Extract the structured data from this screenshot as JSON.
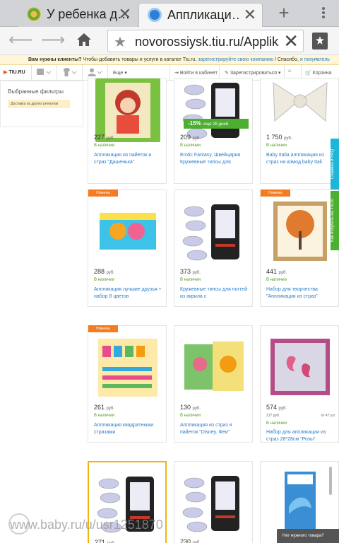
{
  "browser": {
    "tabs": [
      {
        "title": "У ребенка д…",
        "active": false
      },
      {
        "title": "Аппликаци…",
        "active": true
      }
    ],
    "new_tab_symbol": "+",
    "url": "novorossiysk.tiu.ru/Applikats",
    "icons": {
      "back": "arrow-left-icon",
      "forward": "arrow-right-icon",
      "home": "home-icon",
      "star": "star-icon",
      "clear": "close-icon",
      "bookmarks": "bookmarks-icon"
    }
  },
  "promo_bar": {
    "bold": "Вам нужны клиенты?",
    "text": " Чтобы добавить товары и услуги в каталог Tiu.ru, ",
    "link1": "зарегистрируйте свою компанию",
    "text2": " / Спасибо, ",
    "link2": "я покупатель",
    "close": "×"
  },
  "site_header": {
    "logo": "TIU.RU",
    "more": "Еще",
    "login": "Войти в кабинет",
    "register": "Зарегистрироваться",
    "cart": "Корзина"
  },
  "sidebar": {
    "title": "Выбранные фильтры",
    "chip": "Доставка из других регионов"
  },
  "products": [
    {
      "price": "227",
      "currency": "руб.",
      "stock": "В наличии",
      "title": "Аппликация из пайеток и страз \"Дашенька\"",
      "badge": "",
      "img": "doll"
    },
    {
      "price": "209",
      "currency": "руб.",
      "stock": "В наличии",
      "title": "Erotic Fantasy, Швейцария Кружевные типсы для",
      "badge": "",
      "img": "tips"
    },
    {
      "price": "1 750",
      "currency": "руб.",
      "stock": "В наличии",
      "title": "Baby Italia аппликация из страз на комод baby Itali",
      "badge": "",
      "img": "bow"
    },
    {
      "price": "288",
      "currency": "руб.",
      "stock": "В наличии",
      "title": "Аппликация лучшие друзья + набор 8 цветов",
      "badge": "Новинка",
      "img": "friends"
    },
    {
      "price": "373",
      "currency": "руб.",
      "stock": "В наличии",
      "title": "Кружевные типсы для ногтей из акрила с",
      "badge": "",
      "img": "tips"
    },
    {
      "price": "441",
      "currency": "руб.",
      "stock": "В наличии",
      "title": "Набор для творчества \"Аппликация из страз\"",
      "badge": "Новинка",
      "img": "tree"
    },
    {
      "price": "261",
      "currency": "руб.",
      "stock": "В наличии",
      "title": "Аппликация квадратными стразами",
      "badge": "Новинка",
      "img": "letters"
    },
    {
      "price": "130",
      "currency": "руб.",
      "stock": "В наличии",
      "title": "Аппликация из страз и пайеток \"Disney. Феи\"",
      "badge": "",
      "img": "fairy"
    },
    {
      "price": "574",
      "currency": "руб.",
      "stock": "В наличии",
      "title": "Набор для аппликации из страз 28*28см \"Розы\"",
      "badge": "",
      "img": "rose",
      "wholesale_price": "217 руб.",
      "wholesale_qty": "от 47 шт."
    },
    {
      "price": "271",
      "currency": "руб.",
      "stock": "",
      "title": "",
      "badge": "",
      "img": "tips"
    },
    {
      "price": "230",
      "currency": "руб.",
      "stock": "",
      "title": "",
      "badge": "",
      "img": "tips"
    },
    {
      "price": "",
      "currency": "",
      "stock": "",
      "title": "",
      "badge": "",
      "img": "dolphin"
    }
  ],
  "promo_strip": {
    "discount": "-15%",
    "text": "еще 28 дней"
  },
  "side_tabs": [
    "Справка и FAQ",
    "Как покупать на Tiu.ru"
  ],
  "help_widget": "Нет нужного товара?",
  "watermark": "www.baby.ru/u/usr1251870",
  "colors": {
    "accent": "#2a7cc7",
    "badge": "#f47b20",
    "stock": "#4f9e1e",
    "promo_bg": "#fef6d6",
    "sidetab1": "#1eb6d8",
    "sidetab2": "#4caf2f",
    "selected": "#f2b40c"
  }
}
